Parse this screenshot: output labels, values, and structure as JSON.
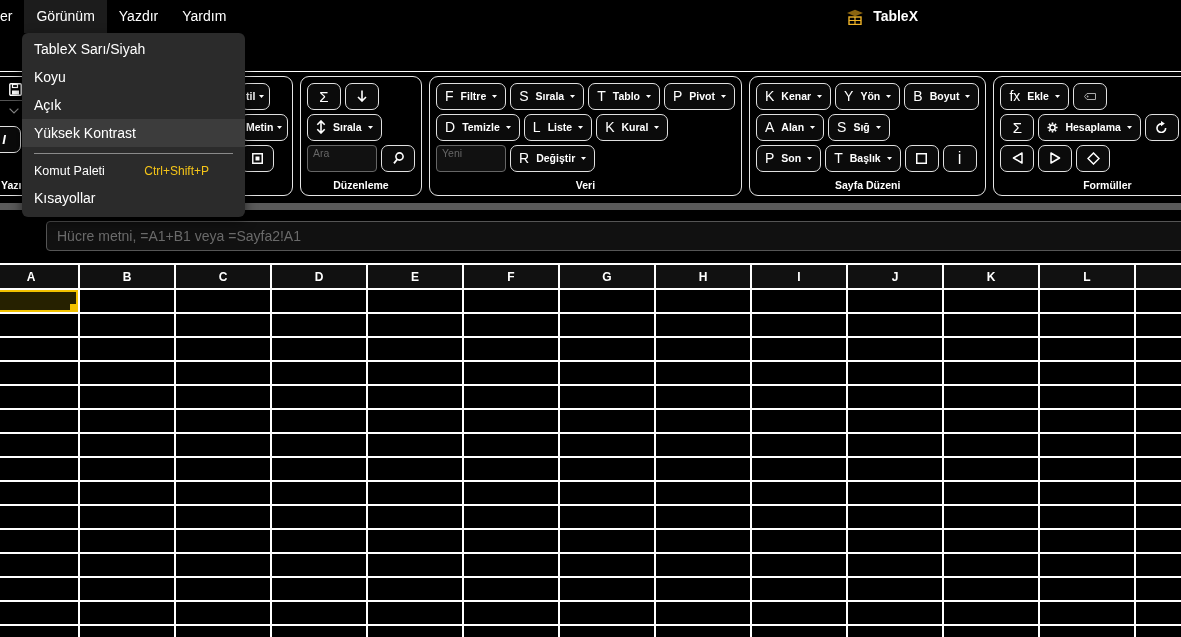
{
  "menubar": {
    "items": [
      {
        "label": "er",
        "selected": false
      },
      {
        "label": "Görünüm",
        "selected": true
      },
      {
        "label": "Yazdır",
        "selected": false
      },
      {
        "label": "Yardım",
        "selected": false
      }
    ]
  },
  "app_title": "TableX",
  "view_menu": {
    "items": [
      {
        "kind": "option",
        "label": "TableX Sarı/Siyah",
        "selected": false
      },
      {
        "kind": "option",
        "label": "Koyu",
        "selected": false
      },
      {
        "kind": "option",
        "label": "Açık",
        "selected": false
      },
      {
        "kind": "option",
        "label": "Yüksek Kontrast",
        "selected": true
      },
      {
        "kind": "divider"
      },
      {
        "kind": "command",
        "label": "Komut Paleti",
        "shortcut": "Ctrl+Shift+P"
      },
      {
        "kind": "command",
        "label": "Kısayollar"
      }
    ]
  },
  "ribbon": {
    "groups": [
      {
        "label": "Yazı",
        "rows": [
          {
            "controls": [
              {
                "kind": "floppy"
              }
            ]
          },
          {
            "controls": [
              {
                "kind": "select"
              }
            ]
          },
          {
            "controls": [
              {
                "kind": "italic",
                "text": "I"
              }
            ]
          }
        ]
      },
      {
        "rows": [
          {
            "controls": [
              {
                "kind": "menu",
                "label": "til"
              }
            ]
          },
          {
            "controls": [
              {
                "kind": "menu",
                "label": "Metin"
              }
            ]
          },
          {
            "controls": [
              {
                "kind": "framed-square"
              }
            ]
          }
        ]
      },
      {
        "label": "Düzenleme",
        "rows": [
          {
            "controls": [
              {
                "kind": "glyph",
                "text": "Σ"
              },
              {
                "kind": "arrow-down"
              }
            ]
          },
          {
            "controls": [
              {
                "kind": "sort-menu",
                "label": "Sırala"
              }
            ]
          },
          {
            "controls": [
              {
                "kind": "field",
                "placeholder": "Ara"
              },
              {
                "kind": "search"
              }
            ]
          }
        ]
      },
      {
        "label": "Veri",
        "rows": [
          {
            "controls": [
              {
                "kind": "menu",
                "key": "F",
                "label": "Filtre"
              },
              {
                "kind": "menu",
                "key": "S",
                "label": "Sırala"
              },
              {
                "kind": "menu",
                "key": "T",
                "label": "Tablo"
              },
              {
                "kind": "menu",
                "key": "P",
                "label": "Pivot"
              }
            ]
          },
          {
            "controls": [
              {
                "kind": "menu",
                "key": "D",
                "label": "Temizle"
              },
              {
                "kind": "menu",
                "key": "L",
                "label": "Liste"
              },
              {
                "kind": "menu",
                "key": "K",
                "label": "Kural"
              }
            ]
          },
          {
            "controls": [
              {
                "kind": "field",
                "placeholder": "Yeni"
              },
              {
                "kind": "menu",
                "key": "R",
                "label": "Değiştir"
              }
            ]
          }
        ]
      },
      {
        "label": "Sayfa Düzeni",
        "rows": [
          {
            "controls": [
              {
                "kind": "menu",
                "key": "K",
                "label": "Kenar"
              },
              {
                "kind": "menu",
                "key": "Y",
                "label": "Yön"
              },
              {
                "kind": "menu",
                "key": "B",
                "label": "Boyut"
              }
            ]
          },
          {
            "controls": [
              {
                "kind": "menu",
                "key": "A",
                "label": "Alan"
              },
              {
                "kind": "menu",
                "key": "S",
                "label": "Sığ"
              }
            ]
          },
          {
            "controls": [
              {
                "kind": "menu",
                "key": "P",
                "label": "Son"
              },
              {
                "kind": "menu",
                "key": "T",
                "label": "Başlık"
              },
              {
                "kind": "square"
              },
              {
                "kind": "glyph",
                "text": "İ"
              }
            ]
          }
        ]
      },
      {
        "label": "Formüller",
        "rows": [
          {
            "controls": [
              {
                "kind": "menu",
                "key": "fx",
                "label": "Ekle"
              },
              {
                "kind": "tag"
              }
            ]
          },
          {
            "controls": [
              {
                "kind": "glyph",
                "text": "Σ"
              },
              {
                "kind": "gear-menu",
                "label": "Hesaplama"
              },
              {
                "kind": "refresh"
              }
            ]
          },
          {
            "controls": [
              {
                "kind": "triangle-left"
              },
              {
                "kind": "triangle-right"
              },
              {
                "kind": "diamond"
              }
            ]
          }
        ]
      }
    ]
  },
  "formula_bar": {
    "placeholder": "Hücre metni, =A1+B1 veya =Sayfa2!A1"
  },
  "grid": {
    "columns": [
      {
        "label": "A"
      },
      {
        "label": "B"
      },
      {
        "label": "C"
      },
      {
        "label": "D"
      },
      {
        "label": "E"
      },
      {
        "label": "F"
      },
      {
        "label": "G"
      },
      {
        "label": "H"
      },
      {
        "label": "I"
      },
      {
        "label": "J"
      },
      {
        "label": "K"
      },
      {
        "label": "L"
      }
    ],
    "rows": [
      {
        "cells": [
          {
            "selected": true
          },
          {
            "selected": false
          },
          {
            "selected": false
          },
          {
            "selected": false
          },
          {
            "selected": false
          },
          {
            "selected": false
          },
          {
            "selected": false
          },
          {
            "selected": false
          },
          {
            "selected": false
          },
          {
            "selected": false
          },
          {
            "selected": false
          },
          {
            "selected": false
          },
          {
            "selected": false
          }
        ]
      },
      {
        "cells": [
          {
            "selected": false
          },
          {
            "selected": false
          },
          {
            "selected": false
          },
          {
            "selected": false
          },
          {
            "selected": false
          },
          {
            "selected": false
          },
          {
            "selected": false
          },
          {
            "selected": false
          },
          {
            "selected": false
          },
          {
            "selected": false
          },
          {
            "selected": false
          },
          {
            "selected": false
          },
          {
            "selected": false
          }
        ]
      },
      {
        "cells": [
          {
            "selected": false
          },
          {
            "selected": false
          },
          {
            "selected": false
          },
          {
            "selected": false
          },
          {
            "selected": false
          },
          {
            "selected": false
          },
          {
            "selected": false
          },
          {
            "selected": false
          },
          {
            "selected": false
          },
          {
            "selected": false
          },
          {
            "selected": false
          },
          {
            "selected": false
          },
          {
            "selected": false
          }
        ]
      },
      {
        "cells": [
          {
            "selected": false
          },
          {
            "selected": false
          },
          {
            "selected": false
          },
          {
            "selected": false
          },
          {
            "selected": false
          },
          {
            "selected": false
          },
          {
            "selected": false
          },
          {
            "selected": false
          },
          {
            "selected": false
          },
          {
            "selected": false
          },
          {
            "selected": false
          },
          {
            "selected": false
          },
          {
            "selected": false
          }
        ]
      },
      {
        "cells": [
          {
            "selected": false
          },
          {
            "selected": false
          },
          {
            "selected": false
          },
          {
            "selected": false
          },
          {
            "selected": false
          },
          {
            "selected": false
          },
          {
            "selected": false
          },
          {
            "selected": false
          },
          {
            "selected": false
          },
          {
            "selected": false
          },
          {
            "selected": false
          },
          {
            "selected": false
          },
          {
            "selected": false
          }
        ]
      },
      {
        "cells": [
          {
            "selected": false
          },
          {
            "selected": false
          },
          {
            "selected": false
          },
          {
            "selected": false
          },
          {
            "selected": false
          },
          {
            "selected": false
          },
          {
            "selected": false
          },
          {
            "selected": false
          },
          {
            "selected": false
          },
          {
            "selected": false
          },
          {
            "selected": false
          },
          {
            "selected": false
          },
          {
            "selected": false
          }
        ]
      },
      {
        "cells": [
          {
            "selected": false
          },
          {
            "selected": false
          },
          {
            "selected": false
          },
          {
            "selected": false
          },
          {
            "selected": false
          },
          {
            "selected": false
          },
          {
            "selected": false
          },
          {
            "selected": false
          },
          {
            "selected": false
          },
          {
            "selected": false
          },
          {
            "selected": false
          },
          {
            "selected": false
          },
          {
            "selected": false
          }
        ]
      },
      {
        "cells": [
          {
            "selected": false
          },
          {
            "selected": false
          },
          {
            "selected": false
          },
          {
            "selected": false
          },
          {
            "selected": false
          },
          {
            "selected": false
          },
          {
            "selected": false
          },
          {
            "selected": false
          },
          {
            "selected": false
          },
          {
            "selected": false
          },
          {
            "selected": false
          },
          {
            "selected": false
          },
          {
            "selected": false
          }
        ]
      },
      {
        "cells": [
          {
            "selected": false
          },
          {
            "selected": false
          },
          {
            "selected": false
          },
          {
            "selected": false
          },
          {
            "selected": false
          },
          {
            "selected": false
          },
          {
            "selected": false
          },
          {
            "selected": false
          },
          {
            "selected": false
          },
          {
            "selected": false
          },
          {
            "selected": false
          },
          {
            "selected": false
          },
          {
            "selected": false
          }
        ]
      },
      {
        "cells": [
          {
            "selected": false
          },
          {
            "selected": false
          },
          {
            "selected": false
          },
          {
            "selected": false
          },
          {
            "selected": false
          },
          {
            "selected": false
          },
          {
            "selected": false
          },
          {
            "selected": false
          },
          {
            "selected": false
          },
          {
            "selected": false
          },
          {
            "selected": false
          },
          {
            "selected": false
          },
          {
            "selected": false
          }
        ]
      },
      {
        "cells": [
          {
            "selected": false
          },
          {
            "selected": false
          },
          {
            "selected": false
          },
          {
            "selected": false
          },
          {
            "selected": false
          },
          {
            "selected": false
          },
          {
            "selected": false
          },
          {
            "selected": false
          },
          {
            "selected": false
          },
          {
            "selected": false
          },
          {
            "selected": false
          },
          {
            "selected": false
          },
          {
            "selected": false
          }
        ]
      },
      {
        "cells": [
          {
            "selected": false
          },
          {
            "selected": false
          },
          {
            "selected": false
          },
          {
            "selected": false
          },
          {
            "selected": false
          },
          {
            "selected": false
          },
          {
            "selected": false
          },
          {
            "selected": false
          },
          {
            "selected": false
          },
          {
            "selected": false
          },
          {
            "selected": false
          },
          {
            "selected": false
          },
          {
            "selected": false
          }
        ]
      },
      {
        "cells": [
          {
            "selected": false
          },
          {
            "selected": false
          },
          {
            "selected": false
          },
          {
            "selected": false
          },
          {
            "selected": false
          },
          {
            "selected": false
          },
          {
            "selected": false
          },
          {
            "selected": false
          },
          {
            "selected": false
          },
          {
            "selected": false
          },
          {
            "selected": false
          },
          {
            "selected": false
          },
          {
            "selected": false
          }
        ]
      },
      {
        "cells": [
          {
            "selected": false
          },
          {
            "selected": false
          },
          {
            "selected": false
          },
          {
            "selected": false
          },
          {
            "selected": false
          },
          {
            "selected": false
          },
          {
            "selected": false
          },
          {
            "selected": false
          },
          {
            "selected": false
          },
          {
            "selected": false
          },
          {
            "selected": false
          },
          {
            "selected": false
          },
          {
            "selected": false
          }
        ]
      },
      {
        "cells": [
          {
            "selected": false
          },
          {
            "selected": false
          },
          {
            "selected": false
          },
          {
            "selected": false
          },
          {
            "selected": false
          },
          {
            "selected": false
          },
          {
            "selected": false
          },
          {
            "selected": false
          },
          {
            "selected": false
          },
          {
            "selected": false
          },
          {
            "selected": false
          },
          {
            "selected": false
          },
          {
            "selected": false
          }
        ]
      }
    ]
  }
}
